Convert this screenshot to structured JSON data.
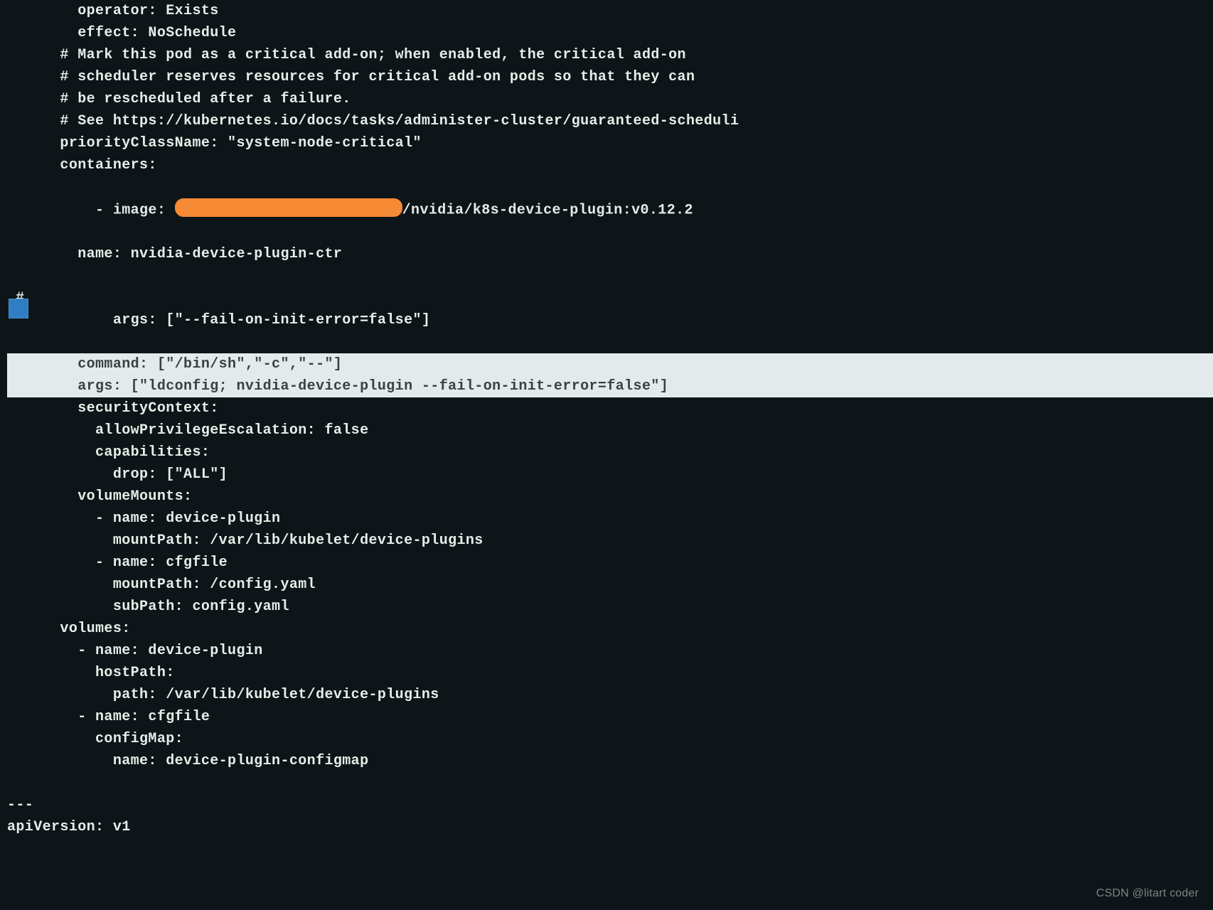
{
  "editor": {
    "lines": {
      "l01": "        operator: Exists",
      "l02": "        effect: NoSchedule",
      "l03": "      # Mark this pod as a critical add-on; when enabled, the critical add-on",
      "l04": "      # scheduler reserves resources for critical add-on pods so that they can",
      "l05": "      # be rescheduled after a failure.",
      "l06": "      # See https://kubernetes.io/docs/tasks/administer-cluster/guaranteed-scheduli",
      "l07": "      priorityClassName: \"system-node-critical\"",
      "l08": "      containers:",
      "l09a": "      - image: ",
      "l09b": "/nvidia/k8s-device-plugin:v0.12.2",
      "l10": "        name: nvidia-device-plugin-ctr",
      "l11_hash": "#",
      "l11": "        args: [\"--fail-on-init-error=false\"]",
      "l12": "        command: [\"/bin/sh\",\"-c\",\"--\"]",
      "l13": "        args: [\"ldconfig; nvidia-device-plugin --fail-on-init-error=false\"]",
      "l14": "        securityContext:",
      "l15": "          allowPrivilegeEscalation: false",
      "l16": "          capabilities:",
      "l17": "            drop: [\"ALL\"]",
      "l18": "        volumeMounts:",
      "l19": "          - name: device-plugin",
      "l20": "            mountPath: /var/lib/kubelet/device-plugins",
      "l21": "          - name: cfgfile",
      "l22": "            mountPath: /config.yaml",
      "l23": "            subPath: config.yaml",
      "l24": "      volumes:",
      "l25": "        - name: device-plugin",
      "l26": "          hostPath:",
      "l27": "            path: /var/lib/kubelet/device-plugins",
      "l28": "        - name: cfgfile",
      "l29": "          configMap:",
      "l30": "            name: device-plugin-configmap",
      "l31": " ",
      "l32": "---",
      "l33": "apiVersion: v1"
    }
  },
  "watermark": {
    "text": "CSDN @litart coder"
  }
}
